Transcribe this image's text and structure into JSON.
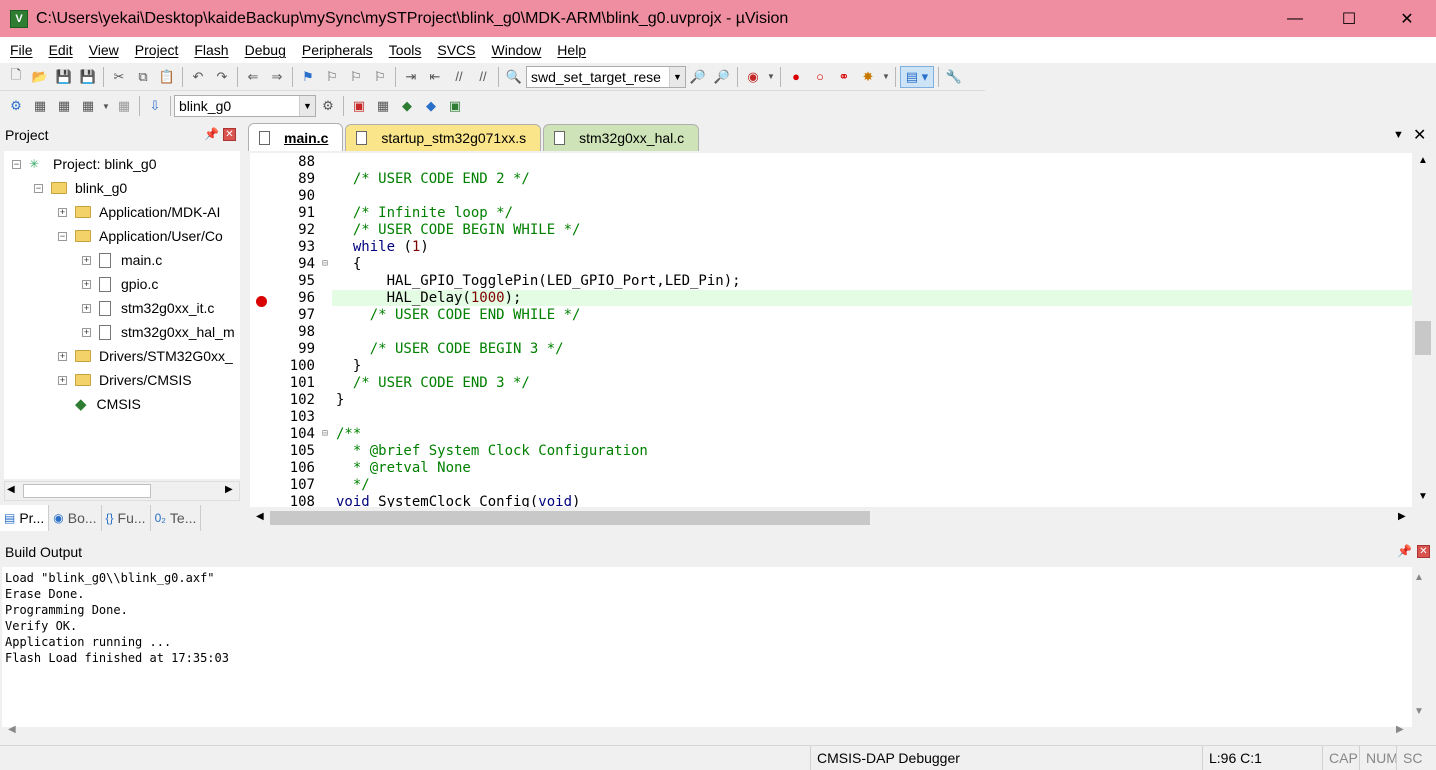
{
  "window": {
    "title": "C:\\Users\\yekai\\Desktop\\kaideBackup\\mySync\\mySTProject\\blink_g0\\MDK-ARM\\blink_g0.uvprojx - µVision",
    "app_icon_text": "V"
  },
  "menu": [
    "File",
    "Edit",
    "View",
    "Project",
    "Flash",
    "Debug",
    "Peripherals",
    "Tools",
    "SVCS",
    "Window",
    "Help"
  ],
  "toolbar1": {
    "target_combo": "swd_set_target_rese"
  },
  "toolbar2": {
    "project_combo": "blink_g0"
  },
  "project_pane": {
    "title": "Project",
    "tree": [
      {
        "label": "Project: blink_g0",
        "level": 0,
        "kind": "project"
      },
      {
        "label": "blink_g0",
        "level": 1,
        "kind": "target"
      },
      {
        "label": "Application/MDK-AI",
        "level": 2,
        "kind": "folder",
        "exp": "+"
      },
      {
        "label": "Application/User/Co",
        "level": 2,
        "kind": "folder",
        "exp": "-"
      },
      {
        "label": "main.c",
        "level": 3,
        "kind": "file",
        "exp": "+"
      },
      {
        "label": "gpio.c",
        "level": 3,
        "kind": "file",
        "exp": "+"
      },
      {
        "label": "stm32g0xx_it.c",
        "level": 3,
        "kind": "file",
        "exp": "+"
      },
      {
        "label": "stm32g0xx_hal_m",
        "level": 3,
        "kind": "file",
        "exp": "+"
      },
      {
        "label": "Drivers/STM32G0xx_",
        "level": 2,
        "kind": "folder",
        "exp": "+"
      },
      {
        "label": "Drivers/CMSIS",
        "level": 2,
        "kind": "folder",
        "exp": "+"
      },
      {
        "label": "CMSIS",
        "level": 2,
        "kind": "component"
      }
    ],
    "tabs": [
      "Pr...",
      "Bo...",
      "Fu...",
      "Te..."
    ]
  },
  "editor": {
    "tabs": [
      {
        "label": "main.c",
        "active": true,
        "color": "#ffffff"
      },
      {
        "label": "startup_stm32g071xx.s",
        "active": false,
        "color": "#fbe58a"
      },
      {
        "label": "stm32g0xx_hal.c",
        "active": false,
        "color": "#cfe3b8"
      }
    ],
    "lines": [
      {
        "n": "88",
        "fold": "",
        "text": ""
      },
      {
        "n": "89",
        "fold": "",
        "text": "  /* USER CODE END 2 */",
        "cls": "cmt"
      },
      {
        "n": "90",
        "fold": "",
        "text": ""
      },
      {
        "n": "91",
        "fold": "",
        "text": "  /* Infinite loop */",
        "cls": "cmt"
      },
      {
        "n": "92",
        "fold": "",
        "text": "  /* USER CODE BEGIN WHILE */",
        "cls": "cmt"
      },
      {
        "n": "93",
        "fold": "",
        "text": "  while (1)",
        "cls": "while"
      },
      {
        "n": "94",
        "fold": "⊟",
        "text": "  {"
      },
      {
        "n": "95",
        "fold": "",
        "text": "      HAL_GPIO_TogglePin(LED_GPIO_Port,LED_Pin);"
      },
      {
        "n": "96",
        "fold": "",
        "text": "      HAL_Delay(1000);",
        "cls": "delay",
        "highlight": true,
        "breakpoint": true
      },
      {
        "n": "97",
        "fold": "",
        "text": "    /* USER CODE END WHILE */",
        "cls": "cmt"
      },
      {
        "n": "98",
        "fold": "",
        "text": ""
      },
      {
        "n": "99",
        "fold": "",
        "text": "    /* USER CODE BEGIN 3 */",
        "cls": "cmt"
      },
      {
        "n": "100",
        "fold": "",
        "text": "  }"
      },
      {
        "n": "101",
        "fold": "",
        "text": "  /* USER CODE END 3 */",
        "cls": "cmt"
      },
      {
        "n": "102",
        "fold": "",
        "text": "}"
      },
      {
        "n": "103",
        "fold": "",
        "text": ""
      },
      {
        "n": "104",
        "fold": "⊟",
        "text": "/**",
        "cls": "cmt"
      },
      {
        "n": "105",
        "fold": "",
        "text": "  * @brief System Clock Configuration",
        "cls": "cmt"
      },
      {
        "n": "106",
        "fold": "",
        "text": "  * @retval None",
        "cls": "cmt"
      },
      {
        "n": "107",
        "fold": "",
        "text": "  */",
        "cls": "cmt"
      },
      {
        "n": "108",
        "fold": "",
        "text": "void SystemClock_Config(void)",
        "cls": "void"
      }
    ]
  },
  "build_output": {
    "title": "Build Output",
    "lines": [
      "Load \"blink_g0\\\\blink_g0.axf\"",
      "Erase Done.",
      "Programming Done.",
      "Verify OK.",
      "Application running ...",
      "Flash Load finished at 17:35:03"
    ]
  },
  "status": {
    "debugger": "CMSIS-DAP Debugger",
    "position": "L:96 C:1",
    "cap": "CAP",
    "num": "NUM",
    "scrl": "SC"
  }
}
